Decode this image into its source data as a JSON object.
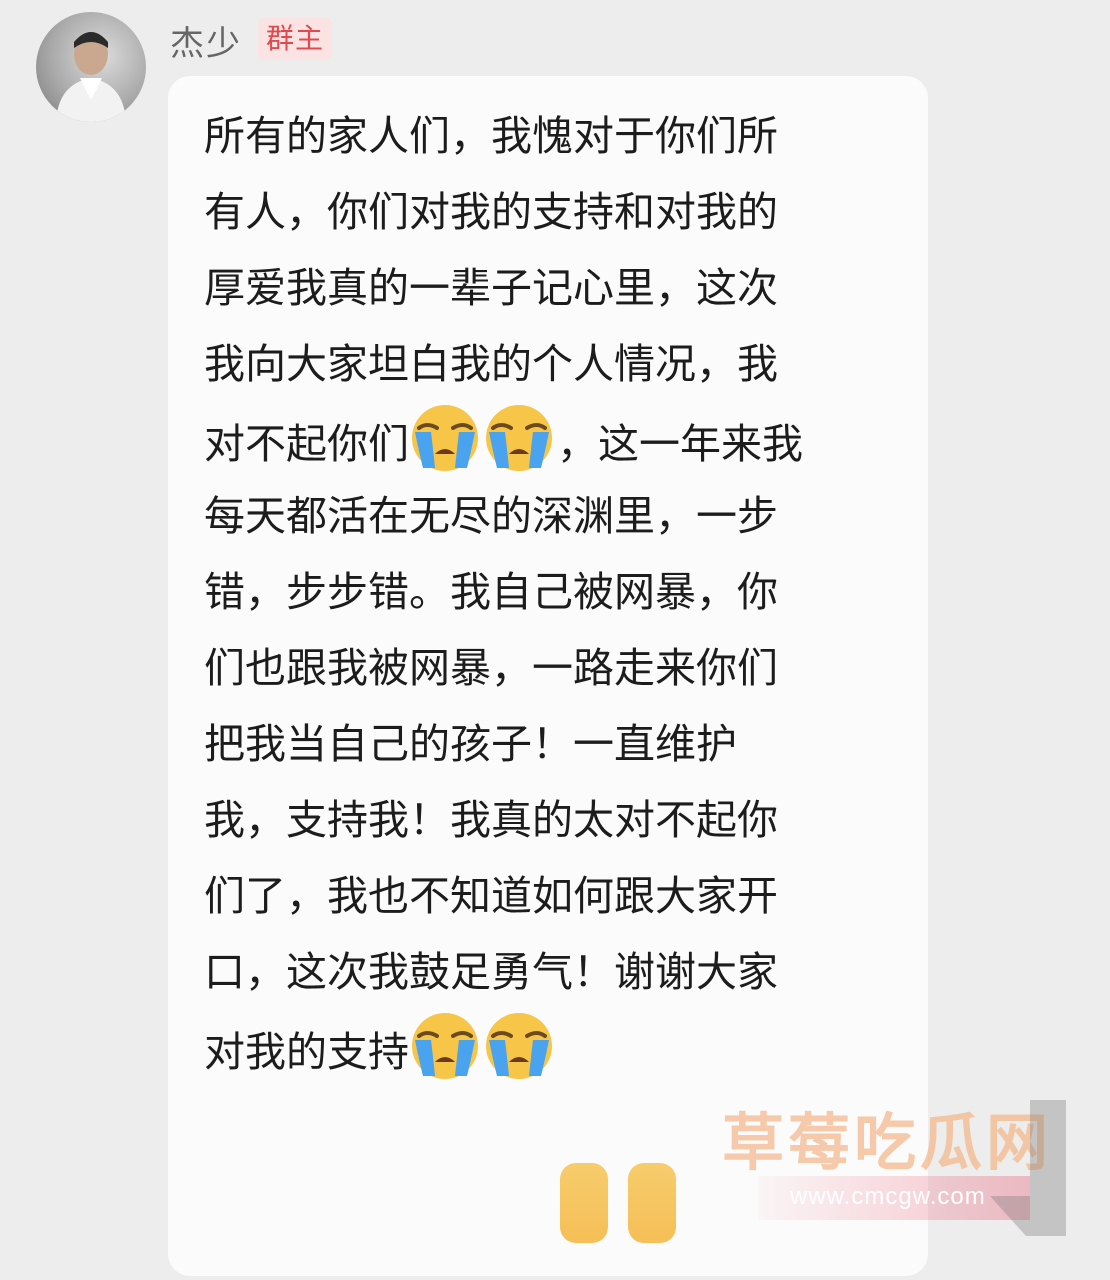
{
  "sender": {
    "name": "杰少",
    "role_badge": "群主"
  },
  "message": {
    "lines": [
      [
        "所有的家人们，我愧对于你们所"
      ],
      [
        "有人，你们对我的支持和对我的"
      ],
      [
        "厚爱我真的一辈子记心里，这次"
      ],
      [
        "我向大家坦白我的个人情况，我"
      ],
      [
        "对不起你们",
        "loudly-crying-face-icon",
        "loudly-crying-face-icon",
        "，这一年来我"
      ],
      [
        "每天都活在无尽的深渊里，一步"
      ],
      [
        "错，步步错。我自己被网暴，你"
      ],
      [
        "们也跟我被网暴，一路走来你们"
      ],
      [
        "把我当自己的孩子！一直维护"
      ],
      [
        "我，支持我！我真的太对不起你"
      ],
      [
        "们了，我也不知道如何跟大家开"
      ],
      [
        "口，这次我鼓足勇气！谢谢大家"
      ],
      [
        "对我的支持",
        "loudly-crying-face-icon",
        "loudly-crying-face-icon"
      ]
    ]
  },
  "watermark": {
    "site_name": "草莓吃瓜网",
    "url": "www.cmcgw.com"
  }
}
